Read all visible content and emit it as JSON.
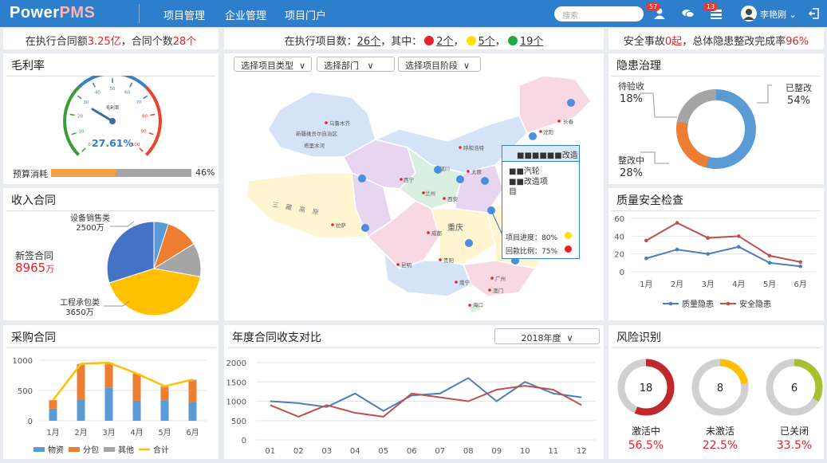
{
  "header": {
    "logo_a": "Power",
    "logo_b": "PMS",
    "nav": [
      "项目管理",
      "企业管理",
      "项目门户"
    ],
    "search_placeholder": "搜索",
    "user_badge": "57",
    "msg_badge": "13",
    "username": "李艳刚",
    "colors": {
      "bar": "#2d7ecb",
      "accent": "#e8202a"
    }
  },
  "stats": {
    "contract": {
      "p1": "在执行合同额",
      "v1": "3.25亿",
      "p2": "，合同个数",
      "v2": "28个"
    },
    "projects": {
      "p1": "在执行项目数：",
      "total": "26个",
      "p2": "，其中：",
      "red": "2个",
      "yellow": "5个",
      "green": "19个"
    },
    "safety": {
      "p1": "安全事故",
      "v1": "0起",
      "p2": "，总体隐患整改完成率",
      "v2": "96%"
    }
  },
  "gross_margin": {
    "title": "毛利率",
    "gauge_label": "毛利率",
    "value": "27.61%",
    "ticks": [
      "0",
      "10",
      "20",
      "30",
      "40",
      "50",
      "60",
      "70",
      "80",
      "90",
      "100"
    ],
    "budget_label": "预算消耗",
    "budget_value": "46%",
    "budget_fraction": 0.46
  },
  "income": {
    "title": "收入合同",
    "new_label": "新签合同",
    "new_value": "8965",
    "new_unit": "万",
    "lab1_name": "设备销售类",
    "lab1_val": "2500万",
    "lab2_name": "工程承包类",
    "lab2_val": "3650万"
  },
  "map": {
    "filters": [
      "选择项目类型",
      "选择部门",
      "选择项目阶段"
    ],
    "popup": {
      "title": "■■■■■■改造",
      "line1": "■■汽轮",
      "line2": "■■改造项",
      "line3": "目",
      "prog_label": "项目进度：",
      "prog_val": "80%",
      "pay_label": "回款比例：",
      "pay_val": "75%"
    },
    "cities": [
      "乌鲁木齐",
      "新疆维吾尔自治区",
      "塔里木河",
      "呼和浩特",
      "沈阳",
      "长春",
      "西宁",
      "兰州",
      "银川",
      "太原",
      "西安",
      "成都",
      "重庆",
      "昆明",
      "贵阳",
      "南宁",
      "广州",
      "澳门",
      "海口",
      "拉萨",
      "天津",
      "上海",
      "长沙"
    ],
    "region": "三藏高原"
  },
  "hazard": {
    "title": "隐患治理",
    "labels": [
      {
        "name": "已整改",
        "pct": "54%"
      },
      {
        "name": "整改中",
        "pct": "28%"
      },
      {
        "name": "待验收",
        "pct": "18%"
      }
    ],
    "chart_data": {
      "type": "pie",
      "categories": [
        "已整改",
        "整改中",
        "待验收"
      ],
      "values": [
        54,
        28,
        18
      ]
    }
  },
  "quality": {
    "title": "质量安全检查",
    "chart_data": {
      "type": "line",
      "categories": [
        "1月",
        "2月",
        "3月",
        "4月",
        "5月",
        "6月"
      ],
      "yticks": [
        "0",
        "20",
        "40",
        "60"
      ],
      "ylim": [
        0,
        60
      ],
      "series": [
        {
          "name": "质量隐患",
          "color": "#4a7ebb",
          "values": [
            15,
            25,
            20,
            28,
            10,
            6
          ]
        },
        {
          "name": "安全隐患",
          "color": "#c0504d",
          "values": [
            35,
            55,
            38,
            40,
            18,
            11
          ]
        }
      ]
    }
  },
  "purchase": {
    "title": "采购合同",
    "chart_data": {
      "type": "bar",
      "categories": [
        "1月",
        "2月",
        "3月",
        "4月",
        "5月",
        "6月"
      ],
      "yticks": [
        "0",
        "500",
        "1000"
      ],
      "ylim": [
        0,
        1000
      ],
      "series": [
        {
          "name": "物资",
          "color": "#5b9bd5",
          "values": [
            200,
            350,
            550,
            330,
            340,
            310
          ]
        },
        {
          "name": "分包",
          "color": "#ed7d31",
          "values": [
            140,
            570,
            380,
            450,
            210,
            350
          ]
        },
        {
          "name": "其他",
          "color": "#a5a5a5",
          "values": [
            0,
            20,
            30,
            0,
            20,
            20
          ]
        },
        {
          "name": "合计",
          "color": "#ffc000",
          "values": [
            340,
            940,
            960,
            780,
            570,
            680
          ]
        }
      ]
    }
  },
  "annual": {
    "title": "年度合同收支对比",
    "year": "2018年度",
    "chart_data": {
      "type": "line",
      "categories": [
        "01",
        "02",
        "03",
        "04",
        "05",
        "06",
        "07",
        "08",
        "09",
        "10",
        "11",
        "12"
      ],
      "yticks": [
        "0",
        "500",
        "1000",
        "1500",
        "2000"
      ],
      "ylim": [
        0,
        2000
      ],
      "series": [
        {
          "color": "#4a7ebb",
          "values": [
            1000,
            950,
            850,
            1200,
            750,
            1150,
            1200,
            1600,
            1000,
            1500,
            1200,
            1100
          ]
        },
        {
          "color": "#c0504d",
          "values": [
            900,
            600,
            900,
            700,
            600,
            1200,
            1100,
            1000,
            1300,
            1400,
            1300,
            900
          ]
        }
      ]
    }
  },
  "risk": {
    "title": "风险识别",
    "items": [
      {
        "count": "18",
        "label": "激活中",
        "pct": "56.5%",
        "color": "#c0282d",
        "frac": 0.565
      },
      {
        "count": "8",
        "label": "未激活",
        "pct": "22.5%",
        "color": "#ffc000",
        "frac": 0.225
      },
      {
        "count": "6",
        "label": "已关闭",
        "pct": "33.5%",
        "color": "#a6c032",
        "frac": 0.335
      }
    ]
  }
}
